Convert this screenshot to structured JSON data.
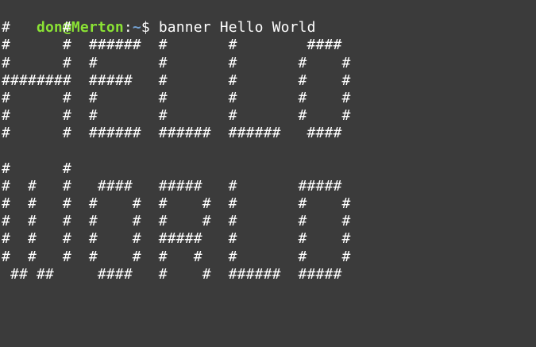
{
  "prompt": {
    "user_host": "don@Merton",
    "colon": ":",
    "path": "~",
    "symbol": "$ ",
    "command": "banner Hello World"
  },
  "output_lines": [
    "#      #",
    "#      #  ######  #       #        ####",
    "#      #  #       #       #       #    #",
    "########  #####   #       #       #    #",
    "#      #  #       #       #       #    #",
    "#      #  #       #       #       #    #",
    "#      #  ######  ######  ######   ####",
    "",
    "#      #",
    "#  #   #   ####   #####   #       #####",
    "#  #   #  #    #  #    #  #       #    #",
    "#  #   #  #    #  #    #  #       #    #",
    "#  #   #  #    #  #####   #       #    #",
    "#  #   #  #    #  #   #   #       #    #",
    " ## ##     ####   #    #  ######  #####"
  ],
  "colors": {
    "background": "#3b3b3b",
    "user_host": "#8ae234",
    "path": "#729fcf",
    "text": "#ffffff"
  }
}
